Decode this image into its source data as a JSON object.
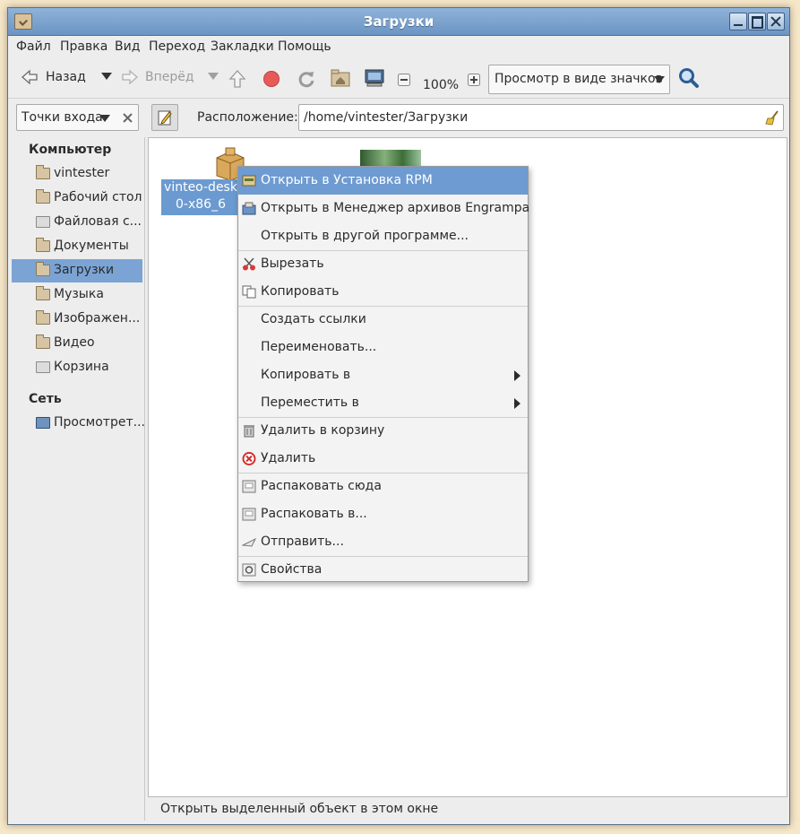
{
  "window": {
    "title": "Загрузки"
  },
  "menubar": [
    "Файл",
    "Правка",
    "Вид",
    "Переход",
    "Закладки",
    "Помощь"
  ],
  "toolbar": {
    "back_label": "Назад",
    "forward_label": "Вперёд",
    "zoom": "100%",
    "view_mode": "Просмотр в виде значков"
  },
  "location": {
    "places_label": "Точки входа",
    "label": "Расположение:",
    "path": "/home/vintester/Загрузки"
  },
  "sidebar": {
    "computer_header": "Компьютер",
    "items": [
      "vintester",
      "Рабочий стол",
      "Файловая с...",
      "Документы",
      "Загрузки",
      "Музыка",
      "Изображен...",
      "Видео",
      "Корзина"
    ],
    "network_header": "Сеть",
    "network_items": [
      "Просмотрет..."
    ]
  },
  "files": [
    {
      "name_line1": "vinteo-desk",
      "name_line2": "0-x86_6"
    }
  ],
  "context_menu": {
    "items": [
      "Открыть в Установка RPM",
      "Открыть в Менеджер архивов Engrampa",
      "Открыть в другой программе...",
      "Вырезать",
      "Копировать",
      "Создать ссылки",
      "Переименовать...",
      "Копировать в",
      "Переместить в",
      "Удалить в корзину",
      "Удалить",
      "Распаковать сюда",
      "Распаковать в...",
      "Отправить...",
      "Свойства"
    ]
  },
  "status": "Открыть выделенный объект в этом окне",
  "colors": {
    "selection": "#6e9bd1",
    "titlebar": "#7aa0cc"
  }
}
